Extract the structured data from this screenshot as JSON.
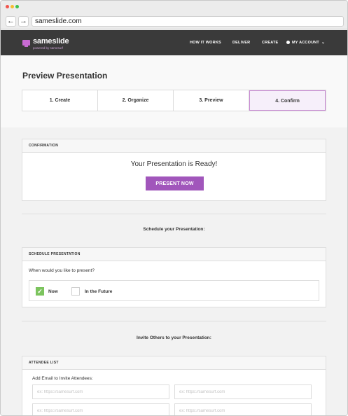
{
  "browser": {
    "url": "sameslide.com",
    "back_icon": "arrow-left",
    "forward_icon": "arrow-right"
  },
  "header": {
    "logo": "sameslide",
    "logo_sub": "powered by samesurf",
    "nav": [
      "HOW IT WORKS",
      "DELIVER",
      "CREATE"
    ],
    "account": "MY ACCOUNT",
    "accent": "#c86bd3"
  },
  "page": {
    "title": "Preview Presentation",
    "steps": [
      "1. Create",
      "2. Organize",
      "3. Preview",
      "4. Confirm"
    ],
    "active_step": "4. Confirm"
  },
  "confirmation": {
    "header": "CONFIRMATION",
    "message": "Your Presentation is Ready!",
    "button": "PRESENT NOW",
    "button_color": "#a156bb"
  },
  "schedule_section": {
    "title": "Schedule your Presentation:",
    "header": "SCHEDULE PRESENTATION",
    "question": "When would you like to present?",
    "options": [
      {
        "label": "Now",
        "checked": true
      },
      {
        "label": "In the Future",
        "checked": false
      }
    ],
    "check_color": "#7cc45e"
  },
  "invite_section": {
    "title": "Invite Others to your Presentation:",
    "header": "ATTENDEE LIST",
    "label": "Add Email to Invite Attendees:",
    "placeholder": "ex: https://samesurf.com"
  }
}
